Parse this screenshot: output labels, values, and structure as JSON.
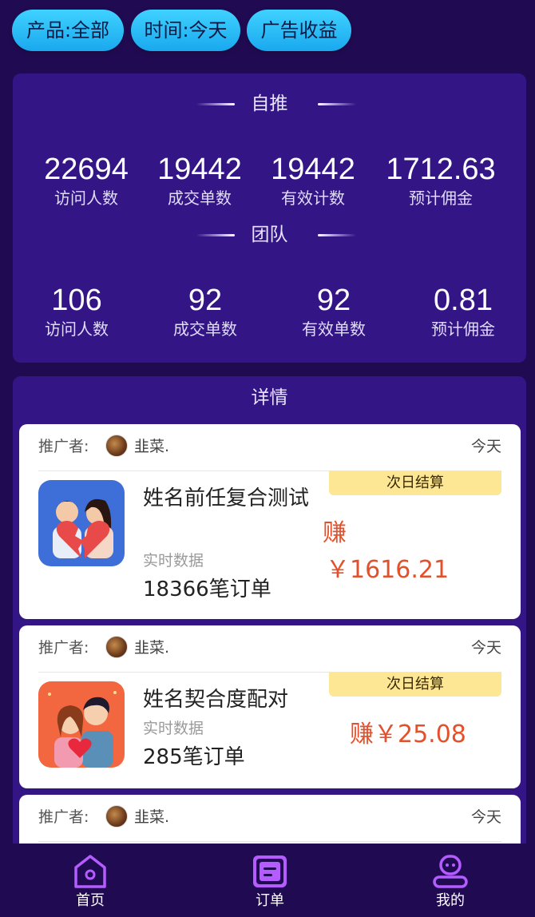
{
  "filters": {
    "product": "产品:全部",
    "time": "时间:今天",
    "ad_income": "广告收益"
  },
  "self": {
    "title": "自推",
    "stats": [
      {
        "value": "22694",
        "label": "访问人数"
      },
      {
        "value": "19442",
        "label": "成交单数"
      },
      {
        "value": "19442",
        "label": "有效计数"
      },
      {
        "value": "1712.63",
        "label": "预计佣金"
      }
    ]
  },
  "team": {
    "title": "团队",
    "stats": [
      {
        "value": "106",
        "label": "访问人数"
      },
      {
        "value": "92",
        "label": "成交单数"
      },
      {
        "value": "92",
        "label": "有效单数"
      },
      {
        "value": "0.81",
        "label": "预计佣金"
      }
    ]
  },
  "details": {
    "title": "详情",
    "cards": [
      {
        "promoter_label": "推广者:",
        "nickname": "韭菜.",
        "date": "今天",
        "tag": "次日结算",
        "name": "姓名前任复合测试",
        "sub": "实时数据",
        "orders": "18366笔订单",
        "earn_label": "赚",
        "earn_amount": "￥1616.21"
      },
      {
        "promoter_label": "推广者:",
        "nickname": "韭菜.",
        "date": "今天",
        "tag": "次日结算",
        "name": "姓名契合度配对",
        "sub": "实时数据",
        "orders": "285笔订单",
        "earn_label": "赚",
        "earn_amount": "￥25.08"
      },
      {
        "promoter_label": "推广者:",
        "nickname": "韭菜.",
        "date": "今天"
      }
    ]
  },
  "tabbar": {
    "items": [
      {
        "label": "首页",
        "icon": "home-icon"
      },
      {
        "label": "订单",
        "icon": "order-icon",
        "active": true
      },
      {
        "label": "我的",
        "icon": "profile-icon"
      }
    ]
  },
  "colors": {
    "background": "#200b52",
    "panel": "#341586",
    "pill": "#1aa8ee",
    "earn": "#e2502c",
    "tag": "#fde694",
    "tab_accent": "#b45cff"
  }
}
